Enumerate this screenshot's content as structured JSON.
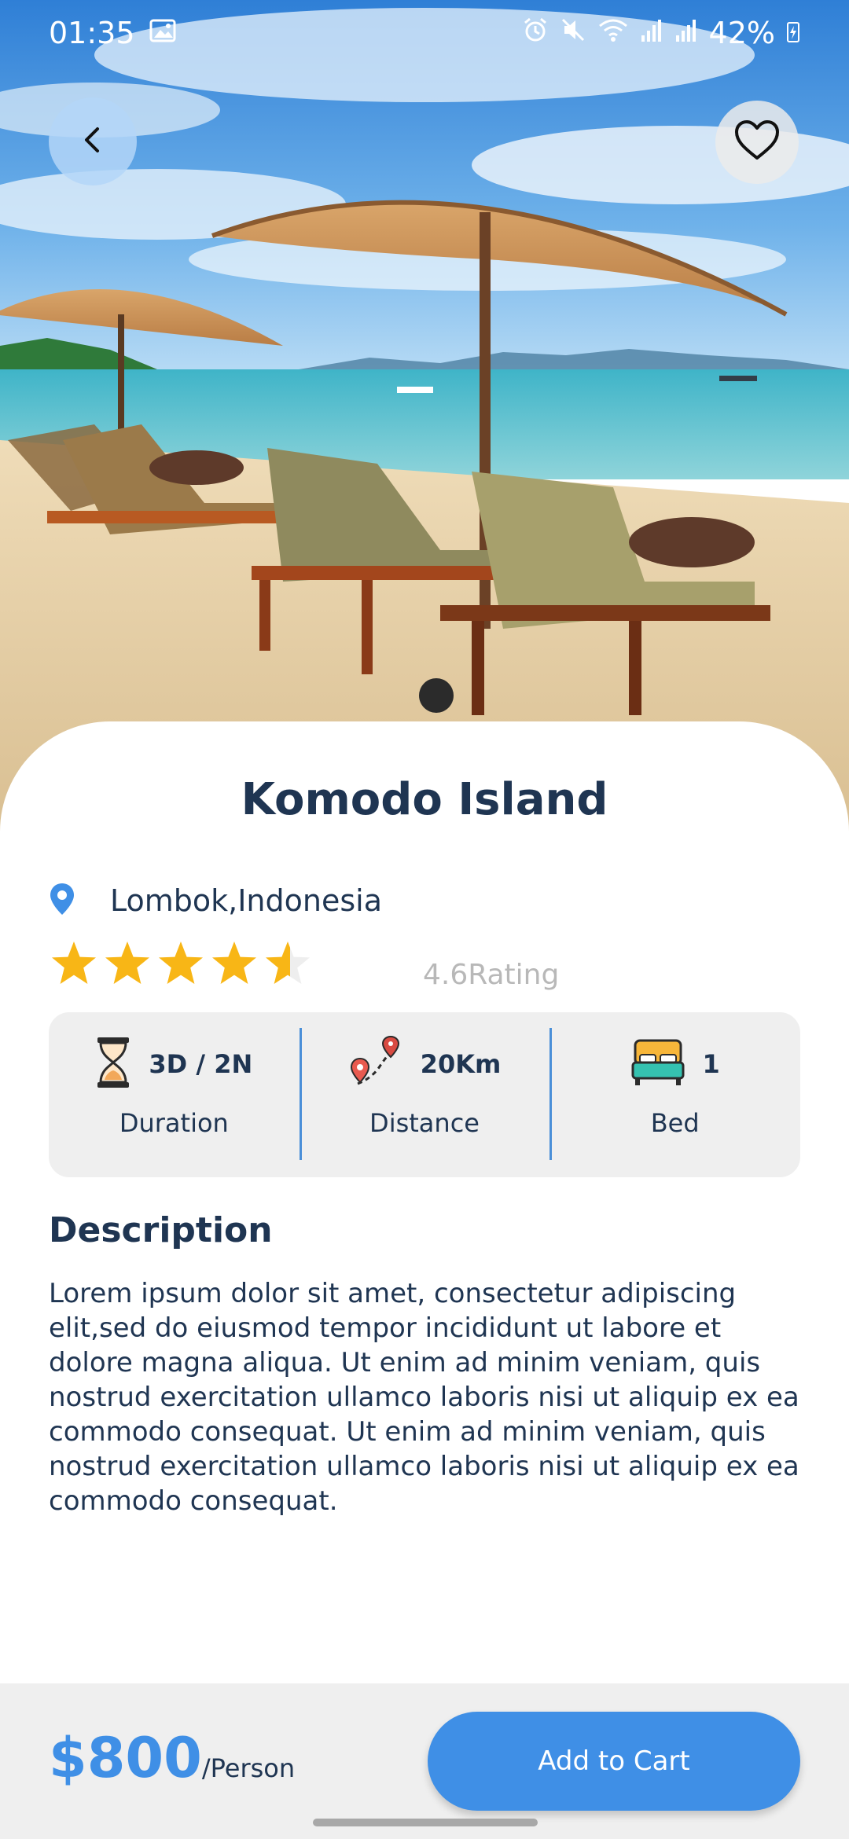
{
  "status_bar": {
    "time": "01:35",
    "battery": "42%"
  },
  "hero": {
    "image": "beach-scene",
    "back_icon": "chevron-left-icon",
    "favorite_icon": "heart-outline-icon"
  },
  "destination": {
    "title": "Komodo Island",
    "location": "Lombok,Indonesia",
    "stars": 4.6,
    "rating_label": "4.6Rating"
  },
  "info": [
    {
      "icon": "hourglass-icon",
      "value": "3D / 2N",
      "label": "Duration"
    },
    {
      "icon": "map-route-icon",
      "value": "20Km",
      "label": "Distance"
    },
    {
      "icon": "bed-icon",
      "value": "1",
      "label": "Bed"
    }
  ],
  "description": {
    "heading": "Description",
    "body": "Lorem ipsum dolor sit amet, consectetur adipiscing elit,sed do eiusmod tempor incididunt ut labore et dolore magna aliqua. Ut enim ad minim veniam, quis nostrud exercitation ullamco laboris nisi ut aliquip  ex ea commodo consequat. Ut enim ad minim  veniam, quis nostrud exercitation ullamco laboris  nisi ut aliquip ex ea commodo consequat."
  },
  "footer": {
    "price": "$800",
    "price_unit": "/Person",
    "cta": "Add to Cart"
  },
  "colors": {
    "accent": "#3f8fe6",
    "text": "#1f3552",
    "star": "#f8b616",
    "muted": "#b8b8b8"
  }
}
